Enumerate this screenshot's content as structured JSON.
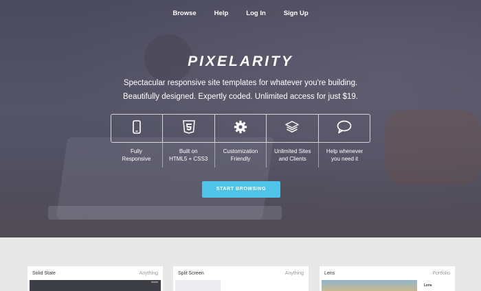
{
  "nav": {
    "items": [
      {
        "label": "Browse"
      },
      {
        "label": "Help"
      },
      {
        "label": "Log In"
      },
      {
        "label": "Sign Up"
      }
    ]
  },
  "hero": {
    "brand": "PIXELARITY",
    "tagline_line1": "Spectacular responsive site templates for whatever you're building.",
    "tagline_line2": "Beautifully designed. Expertly coded. Unlimited access for just $19."
  },
  "features": [
    {
      "icon": "mobile-phone-icon",
      "line1": "Fully",
      "line2": "Responsive"
    },
    {
      "icon": "html5-icon",
      "line1": "Built on",
      "line2": "HTML5 + CSS3"
    },
    {
      "icon": "gear-icon",
      "line1": "Customization",
      "line2": "Friendly"
    },
    {
      "icon": "layers-icon",
      "line1": "Unlimited Sites",
      "line2": "and Clients"
    },
    {
      "icon": "speech-bubble-icon",
      "line1": "Help whenever",
      "line2": "you need it"
    }
  ],
  "cta": {
    "label": "START BROWSING"
  },
  "cards": [
    {
      "title": "Solid State",
      "category": "Anything"
    },
    {
      "title": "Split Screen",
      "category": "Anything"
    },
    {
      "title": "Lens",
      "category": "Portfolio",
      "thumb_text": "Lens"
    }
  ],
  "colors": {
    "hero_overlay": "#4b4a5e",
    "cta": "#4fc3e8",
    "page_bg": "#e8e8e8"
  }
}
